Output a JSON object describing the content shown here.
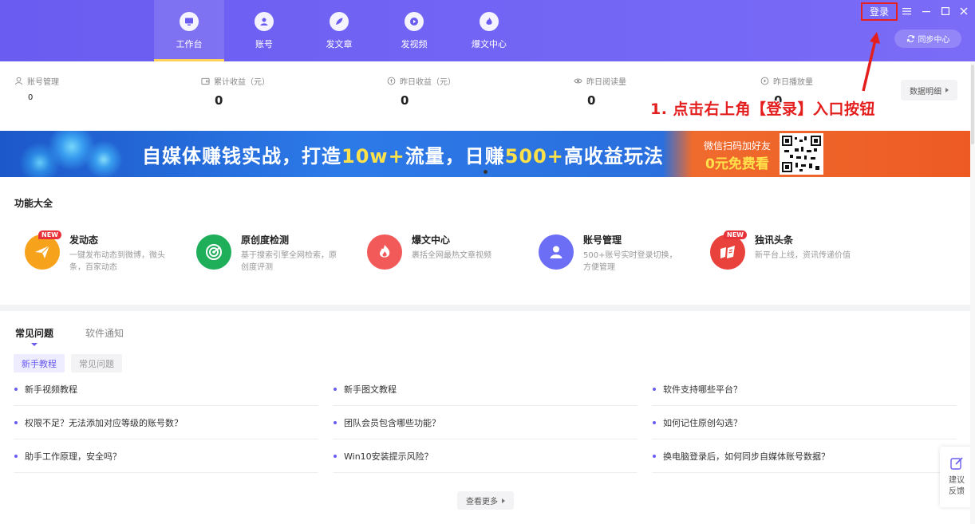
{
  "header": {
    "nav": [
      {
        "label": "工作台",
        "icon": "monitor-icon",
        "active": true
      },
      {
        "label": "账号",
        "icon": "user-icon",
        "active": false
      },
      {
        "label": "发文章",
        "icon": "feather-icon",
        "active": false
      },
      {
        "label": "发视频",
        "icon": "play-icon",
        "active": false
      },
      {
        "label": "爆文中心",
        "icon": "fire-icon",
        "active": false
      }
    ],
    "login_label": "登录",
    "sync_label": "同步中心"
  },
  "stats": {
    "account": {
      "label": "账号管理",
      "value": "0"
    },
    "total_income": {
      "label": "累计收益（元）",
      "value": "0"
    },
    "yesterday_income": {
      "label": "昨日收益（元）",
      "value": "0"
    },
    "yesterday_reads": {
      "label": "昨日阅读量",
      "value": "0"
    },
    "yesterday_plays": {
      "label": "昨日播放量",
      "value": "0"
    },
    "detail_label": "数据明细"
  },
  "annotation": "1. 点击右上角【登录】入口按钮",
  "banner": {
    "title_a": "自媒体赚钱实战，打造",
    "title_b": "10w+",
    "title_c": "流量，日赚",
    "title_d": "500+",
    "title_e": "高收益玩法",
    "sub1": "微信扫码加好友",
    "sub2": "0元免费看"
  },
  "features": {
    "title": "功能大全",
    "items": [
      {
        "name": "发动态",
        "desc": "一键发布动态到微博，微头条，百家动态",
        "badge": "NEW",
        "color": "#f7a21b"
      },
      {
        "name": "原创度检测",
        "desc": "基于搜索引擎全网检索，原创度评测",
        "badge": "",
        "color": "#1fae5a"
      },
      {
        "name": "爆文中心",
        "desc": "裹括全网最热文章视频",
        "badge": "",
        "color": "#f25a5a"
      },
      {
        "name": "账号管理",
        "desc": "500+账号实时登录切换，方便管理",
        "badge": "",
        "color": "#6c6ef5"
      },
      {
        "name": "独讯头条",
        "desc": "新平台上线，资讯传递价值",
        "badge": "NEW",
        "color": "#e9413b"
      }
    ]
  },
  "faq": {
    "tabs": [
      "常见问题",
      "软件通知"
    ],
    "chips": [
      "新手教程",
      "常见问题"
    ],
    "questions": [
      [
        "新手视频教程",
        "新手图文教程",
        "软件支持哪些平台？"
      ],
      [
        "权限不足？无法添加对应等级的账号数？",
        "团队会员包含哪些功能？",
        "如何记住原创勾选？"
      ],
      [
        "助手工作原理，安全吗？",
        "Win10安装提示风险？",
        "换电脑登录后，如何同步自媒体账号数据？"
      ]
    ],
    "more_label": "查看更多"
  },
  "feedback": {
    "label": "建议反馈"
  },
  "colors": {
    "primary": "#6a5cf0",
    "annotation_red": "#e41d1d",
    "highlight": "#ffe14a"
  }
}
